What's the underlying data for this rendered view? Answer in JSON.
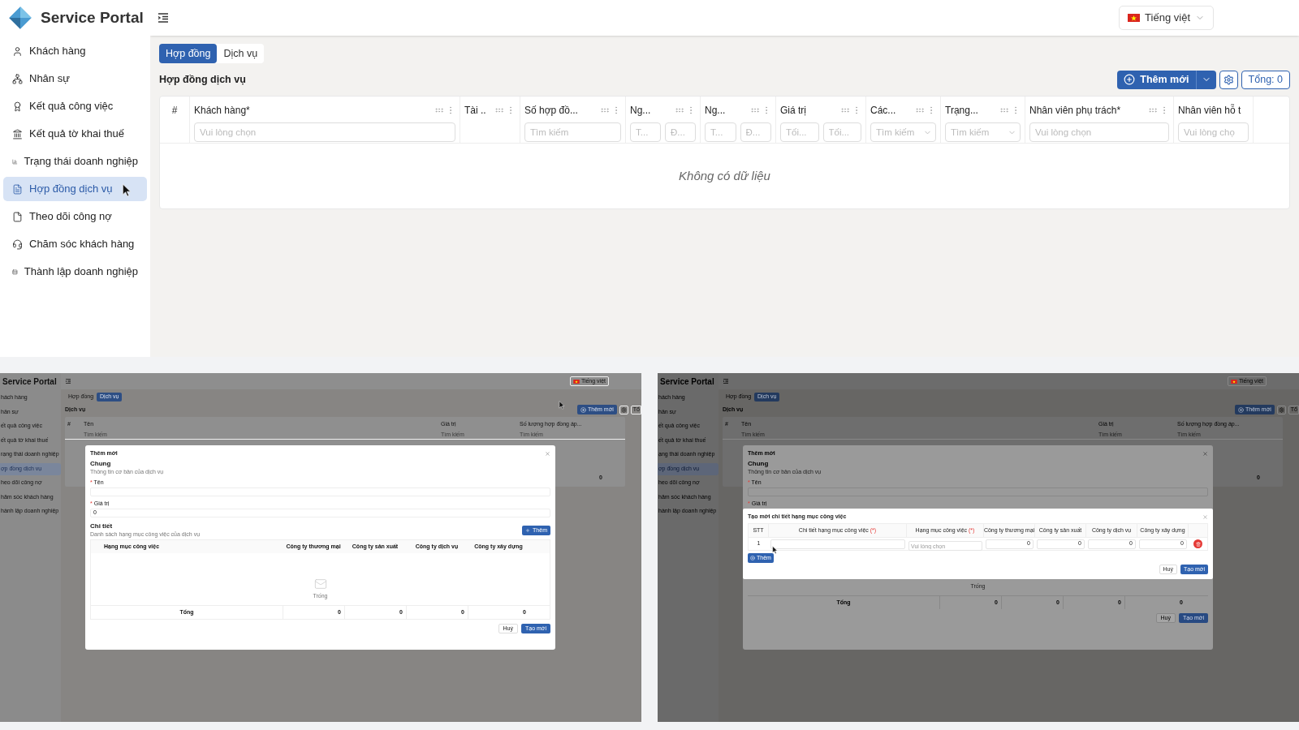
{
  "main": {
    "logo": "Service Portal",
    "language": "Tiếng việt",
    "sidebar": [
      {
        "label": "Khách hàng",
        "selected": false
      },
      {
        "label": "Nhân sự",
        "selected": false
      },
      {
        "label": "Kết quả công việc",
        "selected": false
      },
      {
        "label": "Kết quả tờ khai thuế",
        "selected": false
      },
      {
        "label": "Trạng thái doanh nghiệp",
        "selected": false
      },
      {
        "label": "Hợp đồng dịch vụ",
        "selected": true
      },
      {
        "label": "Theo dõi công nợ",
        "selected": false
      },
      {
        "label": "Chăm sóc khách hàng",
        "selected": false
      },
      {
        "label": "Thành lập doanh nghiệp",
        "selected": false
      }
    ],
    "tabs": [
      {
        "label": "Hợp đồng",
        "selected": true
      },
      {
        "label": "Dịch vụ",
        "selected": false
      }
    ],
    "heading": "Hợp đồng dịch vụ",
    "add_button": "Thêm mới",
    "total": "Tổng: 0",
    "table": {
      "columns": [
        {
          "title": "#"
        },
        {
          "title": "Khách hàng*",
          "filters": [
            {
              "kind": "input",
              "placeholder": "Vui lòng chọn"
            }
          ]
        },
        {
          "title": "Tài .."
        },
        {
          "title": "Số hợp đồ...",
          "filters": [
            {
              "kind": "input",
              "placeholder": "Tìm kiếm"
            }
          ]
        },
        {
          "title": "Ng...",
          "filters": [
            {
              "kind": "input",
              "placeholder": "T..."
            },
            {
              "kind": "input",
              "placeholder": "Đ..."
            }
          ]
        },
        {
          "title": "Ng...",
          "filters": [
            {
              "kind": "input",
              "placeholder": "T..."
            },
            {
              "kind": "input",
              "placeholder": "Đ..."
            }
          ]
        },
        {
          "title": "Giá trị",
          "filters": [
            {
              "kind": "input",
              "placeholder": "Tối..."
            },
            {
              "kind": "input",
              "placeholder": "Tối..."
            }
          ]
        },
        {
          "title": "Các...",
          "filters": [
            {
              "kind": "select",
              "placeholder": "Tìm kiếm"
            }
          ]
        },
        {
          "title": "Trạng...",
          "filters": [
            {
              "kind": "select",
              "placeholder": "Tìm kiếm"
            }
          ]
        },
        {
          "title": "Nhân viên phụ trách*",
          "filters": [
            {
              "kind": "input",
              "placeholder": "Vui lòng chọn"
            }
          ]
        },
        {
          "title": "Nhân viên hỗ t",
          "filters": [
            {
              "kind": "input",
              "placeholder": "Vui lòng chọ"
            }
          ]
        }
      ],
      "empty": "Không có dữ liệu"
    }
  },
  "screenshots": [
    {
      "logo": "Service Portal",
      "language": "Tiếng việt",
      "sidebar": [
        {
          "label": "hách hàng",
          "selected": false
        },
        {
          "label": "hân sự",
          "selected": false
        },
        {
          "label": "ết quả công việc",
          "selected": false
        },
        {
          "label": "ết quả tờ khai thuế",
          "selected": false
        },
        {
          "label": "rạng thái doanh nghiệp",
          "selected": false
        },
        {
          "label": "ợp đồng dịch vụ",
          "selected": true
        },
        {
          "label": "heo dõi công nợ",
          "selected": false
        },
        {
          "label": "hăm sóc khách hàng",
          "selected": false
        },
        {
          "label": "hành lập doanh nghiệp",
          "selected": false
        }
      ],
      "tabs": [
        {
          "label": "Hợp đồng",
          "selected": false
        },
        {
          "label": "Dịch vụ",
          "selected": true
        }
      ],
      "heading": "Dịch vụ",
      "add_button": "Thêm mới",
      "total": "Tổ",
      "table": {
        "columns": [
          {
            "title": "#"
          },
          {
            "title": "Tên",
            "placeholder": "Tìm kiếm"
          },
          {
            "title": "Giá trị",
            "placeholder": "Tìm kiếm"
          },
          {
            "title": "Số lượng hợp đồng áp...",
            "placeholder": "Tìm kiếm"
          }
        ],
        "row_cell": "0"
      },
      "dialog": {
        "title": "Thêm mới",
        "section": "Chung",
        "description": "Thông tin cơ bản của dịch vụ",
        "fields": [
          {
            "label": "Tên",
            "mark": "*"
          },
          {
            "label": "Giá trị",
            "mark": "*",
            "value": "0"
          }
        ],
        "detail": {
          "section": "Chi tiết",
          "description": "Danh sách hạng mục công việc của dịch vụ",
          "add_button": "Thêm"
        },
        "table": {
          "columns": [
            "Hạng mục công việc",
            "Công ty thương mại",
            "Công ty sản xuất",
            "Công ty dịch vụ",
            "Công ty xây dựng"
          ],
          "empty": "Trống",
          "total_label": "Tổng",
          "totals": [
            "0",
            "0",
            "0",
            "0"
          ]
        },
        "cancel": "Huỷ",
        "submit": "Tạo mới"
      }
    },
    {
      "logo": "Service Portal",
      "language": "Tiếng việt",
      "sidebar": [
        {
          "label": "hách hàng",
          "selected": false
        },
        {
          "label": "hân sự",
          "selected": false
        },
        {
          "label": "ết quả công việc",
          "selected": false
        },
        {
          "label": "ết quả tờ khai thuế",
          "selected": false
        },
        {
          "label": "ạng thái doanh nghiệp",
          "selected": false
        },
        {
          "label": "ợp đồng dịch vụ",
          "selected": true
        },
        {
          "label": "heo dõi công nợ",
          "selected": false
        },
        {
          "label": "hăm sóc khách hàng",
          "selected": false
        },
        {
          "label": "hành lập doanh nghiệp",
          "selected": false
        }
      ],
      "tabs": [
        {
          "label": "Hợp đồng",
          "selected": false
        },
        {
          "label": "Dịch vụ",
          "selected": true
        }
      ],
      "heading": "Dịch vụ",
      "add_button": "Thêm mới",
      "total": "Tổ",
      "table": {
        "columns": [
          {
            "title": "#"
          },
          {
            "title": "Tên",
            "placeholder": "Tìm kiếm"
          },
          {
            "title": "Giá trị",
            "placeholder": "Tìm kiếm"
          },
          {
            "title": "Số lượng hợp đồng áp...",
            "placeholder": "Tìm kiếm"
          }
        ],
        "row_cell": "0"
      },
      "dialog": {
        "title": "Thêm mới",
        "section": "Chung",
        "description": "Thông tin cơ bản của dịch vụ",
        "fields": [
          {
            "label": "Tên",
            "mark": "*"
          },
          {
            "label": "Giá trị",
            "mark": "*"
          }
        ],
        "table": {
          "empty": "Trống",
          "total_label": "Tổng",
          "totals": [
            "0",
            "0",
            "0",
            "0"
          ]
        },
        "cancel": "Huỷ",
        "submit": "Tạo mới"
      },
      "sub_dialog": {
        "title": "Tạo mới chi tiết hạng mục công việc",
        "columns": [
          {
            "title": "STT"
          },
          {
            "title": "Chi tiết hạng mục công việc",
            "mark": "(*)"
          },
          {
            "title": "Hạng mục công việc",
            "mark": "(*)"
          },
          {
            "title": "Công ty thương mại"
          },
          {
            "title": "Công ty sản xuất"
          },
          {
            "title": "Công ty dịch vụ"
          },
          {
            "title": "Công ty xây dựng"
          }
        ],
        "rows": [
          {
            "stt": "1",
            "category_placeholder": "Vui lòng chọn",
            "values": [
              "0",
              "0",
              "0",
              "0"
            ]
          }
        ],
        "add_button": "Thêm",
        "cancel": "Huỷ",
        "submit": "Tạo mới"
      }
    }
  ]
}
